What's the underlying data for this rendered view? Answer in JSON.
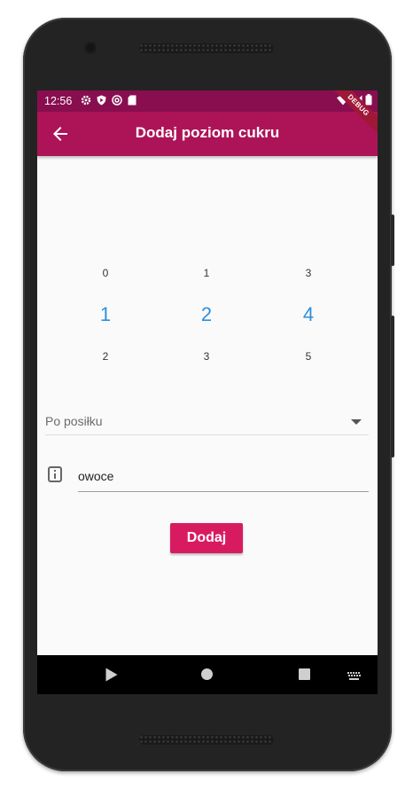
{
  "status_bar": {
    "time": "12:56",
    "left_icons": [
      "gear-icon",
      "shield-play-icon",
      "at-icon",
      "sd-card-icon"
    ],
    "right_icons": [
      "wifi-icon",
      "signal-icon",
      "battery-icon"
    ]
  },
  "app_bar": {
    "title": "Dodaj poziom cukru",
    "back_icon": "arrow-back-icon",
    "color": "#ad1457",
    "status_color": "#880e4f"
  },
  "debug_banner": "DEBUG",
  "pickers": [
    {
      "prev": "0",
      "current": "1",
      "next": "2"
    },
    {
      "prev": "1",
      "current": "2",
      "next": "3"
    },
    {
      "prev": "3",
      "current": "4",
      "next": "5"
    }
  ],
  "dropdown": {
    "selected": "Po posiłku",
    "icon": "caret-down-icon"
  },
  "note_field": {
    "value": "owoce",
    "icon": "info-icon"
  },
  "submit_button": {
    "label": "Dodaj",
    "color": "#d81b60"
  },
  "nav_bar": {
    "icons": [
      "back-triangle-icon",
      "home-circle-icon",
      "recents-square-icon",
      "keyboard-icon"
    ]
  },
  "accent_color": "#2f8fdc"
}
